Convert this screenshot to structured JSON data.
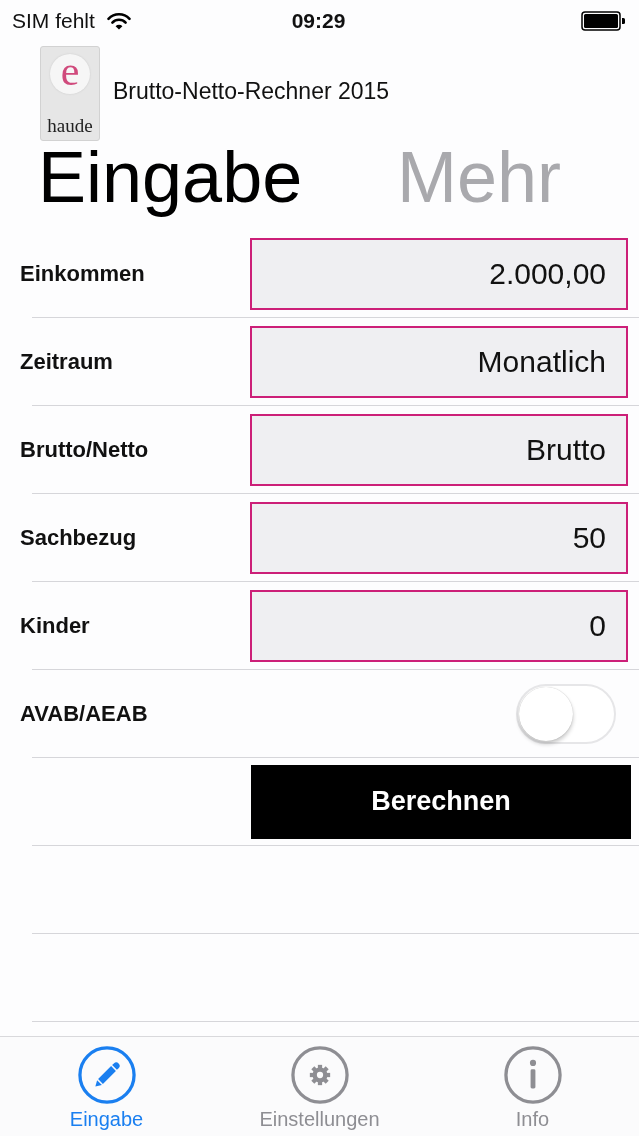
{
  "status_bar": {
    "carrier": "SIM fehlt",
    "time": "09:29"
  },
  "header": {
    "logo": {
      "letter": "e",
      "word": "haude"
    },
    "title": "Brutto-Netto-Rechner 2015"
  },
  "page_tabs": [
    {
      "label": "Eingabe",
      "selected": true
    },
    {
      "label": "Mehr",
      "selected": false
    }
  ],
  "form": {
    "rows": [
      {
        "kind": "field",
        "label": "Einkommen",
        "value": "2.000,00"
      },
      {
        "kind": "field",
        "label": "Zeitraum",
        "value": "Monatlich"
      },
      {
        "kind": "field",
        "label": "Brutto/Netto",
        "value": "Brutto"
      },
      {
        "kind": "field",
        "label": "Sachbezug",
        "value": "50"
      },
      {
        "kind": "field",
        "label": "Kinder",
        "value": "0"
      },
      {
        "kind": "toggle",
        "label": "AVAB/AEAB",
        "on": false
      },
      {
        "kind": "button",
        "label": "Berechnen"
      }
    ]
  },
  "tab_bar": [
    {
      "label": "Eingabe",
      "selected": true
    },
    {
      "label": "Einstellungen",
      "selected": false
    },
    {
      "label": "Info",
      "selected": false
    }
  ]
}
